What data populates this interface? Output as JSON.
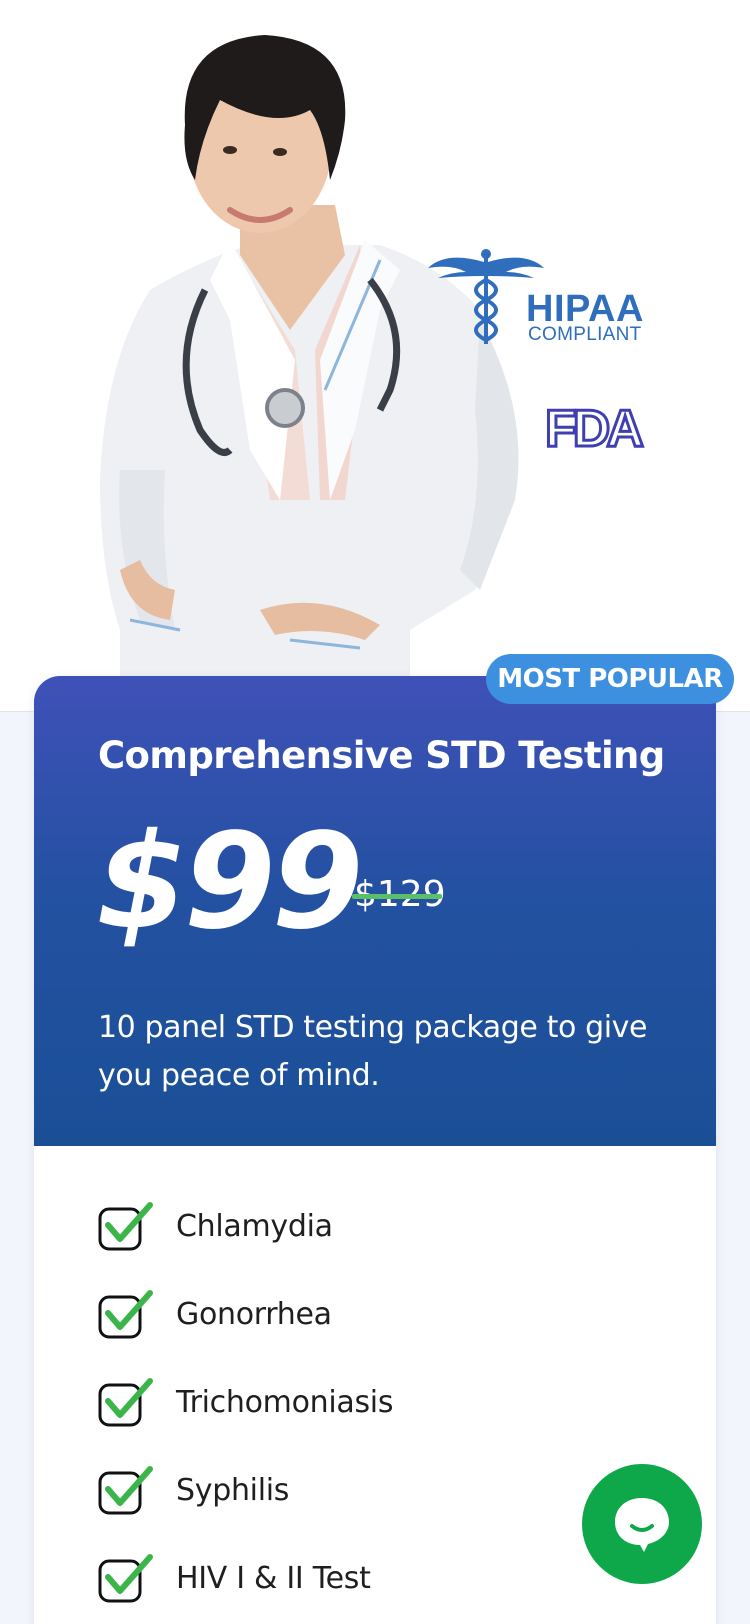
{
  "badges": {
    "hipaa_title": "HIPAA",
    "hipaa_sub": "COMPLIANT",
    "fda": "FDA"
  },
  "card": {
    "ribbon": "MOST POPULAR",
    "title": "Comprehensive STD Testing",
    "price": "$99",
    "old_price": "$129",
    "description": "10 panel STD testing package to give you peace of mind.",
    "features": [
      "Chlamydia",
      "Gonorrhea",
      "Trichomoniasis",
      "Syphilis",
      "HIV I & II Test"
    ]
  },
  "colors": {
    "header_gradient_top": "#3f51b8",
    "header_gradient_bottom": "#1a4f96",
    "ribbon": "#3d8fe0",
    "check": "#3bb54a",
    "chat": "#0ea84a"
  },
  "icons": {
    "hipaa": "caduceus-icon",
    "fda": "fda-logo",
    "check": "checkbox-checked-icon",
    "chat": "chat-bubble-icon"
  }
}
